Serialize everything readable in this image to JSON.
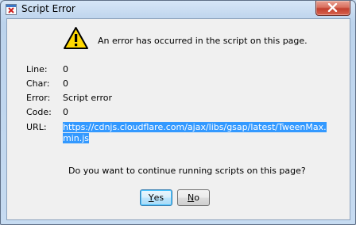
{
  "window": {
    "title": "Script Error"
  },
  "dialog": {
    "message": "An error has occurred in the script on this page.",
    "fields": [
      {
        "label": "Line:",
        "value": "0"
      },
      {
        "label": "Char:",
        "value": "0"
      },
      {
        "label": "Error:",
        "value": "Script error"
      },
      {
        "label": "Code:",
        "value": "0"
      }
    ],
    "url_label": "URL:",
    "url_line1": "https://cdnjs.cloudflare.com/ajax/libs/gsap/latest/TweenMax.",
    "url_line2": "min.js",
    "question": "Do you want to continue running scripts on this page?"
  },
  "buttons": {
    "yes_mnemonic": "Y",
    "yes_rest": "es",
    "no_mnemonic": "N",
    "no_rest": "o"
  },
  "colors": {
    "selection": "#3399ff",
    "close_button": "#c2402f",
    "warning": "#ffd800"
  }
}
